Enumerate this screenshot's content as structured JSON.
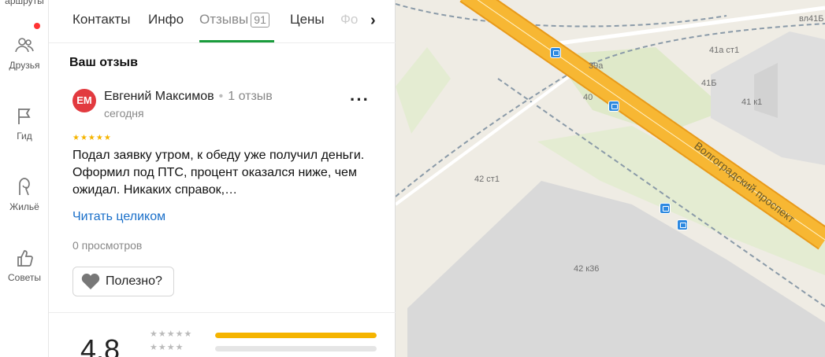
{
  "rail": {
    "top_label": "аршруты",
    "items": [
      {
        "label": "Друзья",
        "icon": "friends-icon"
      },
      {
        "label": "Гид",
        "icon": "flag-icon"
      },
      {
        "label": "Жильё",
        "icon": "housing-icon"
      },
      {
        "label": "Советы",
        "icon": "thumbs-up-icon"
      }
    ]
  },
  "tabs": {
    "items": [
      "Контакты",
      "Инфо",
      "Отзывы",
      "Цены",
      "Фо"
    ],
    "reviews_count": "91",
    "active": "Отзывы"
  },
  "review": {
    "section_title": "Ваш отзыв",
    "avatar_initials": "ЕМ",
    "author": "Евгений Максимов",
    "author_reviews": "1 отзыв",
    "date": "сегодня",
    "stars": 5,
    "text": "Подал заявку утром, к обеду уже получил деньги. Оформил под ПТС, процент оказался ниже, чем ожидал. Никаких справок,…",
    "read_more": "Читать целиком",
    "views": "0 просмотров",
    "useful_label": "Полезно?"
  },
  "summary": {
    "rating": "4.8",
    "rows": [
      {
        "stars": 5,
        "fraction": 1.0
      },
      {
        "stars": 4,
        "fraction": 0.0
      }
    ]
  },
  "map": {
    "labels": [
      "вл41Б",
      "41а ст1",
      "39а",
      "41Б",
      "40",
      "41 к1",
      "42 ст1",
      "42 к36"
    ],
    "road_name": "Волгоградский проспект",
    "colors": {
      "highway": "#f7b733",
      "highway_edge": "#e89a1a",
      "building": "#d9d9d9",
      "green": "#dfe9c9"
    }
  },
  "colors": {
    "accent_green": "#1a9c3c",
    "star": "#f5b400",
    "link": "#1a6fc9",
    "avatar": "#e23a3f"
  }
}
